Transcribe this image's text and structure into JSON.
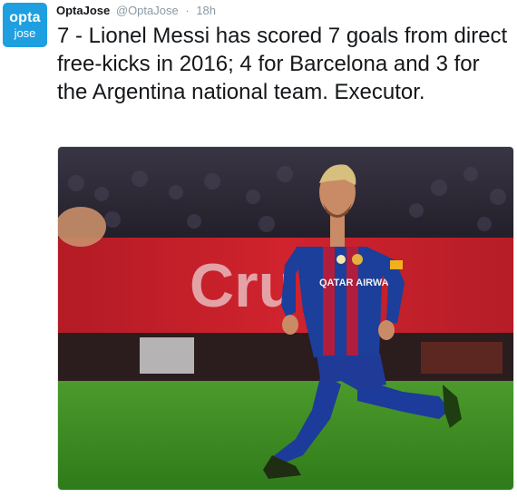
{
  "avatar": {
    "line1": "opta",
    "line2": "jose"
  },
  "tweet": {
    "display_name": "OptaJose",
    "handle": "@OptaJose",
    "separator": "·",
    "time": "18h",
    "text": "7 - Lionel Messi has scored 7 goals from direct free-kicks in 2016; 4 for Barcelona and 3 for the Argentina national team. Executor."
  },
  "media": {
    "banner_text": "Cru",
    "shirt_sponsor": "QATAR AIRWAYS",
    "colors": {
      "crowd": "#2a2633",
      "banner": "#c8202b",
      "pitch": "#3f8f23",
      "shirt_blue": "#1b3f9b",
      "shirt_red": "#b01d3d",
      "shorts": "#203a97",
      "boots": "#1f2d12"
    }
  }
}
